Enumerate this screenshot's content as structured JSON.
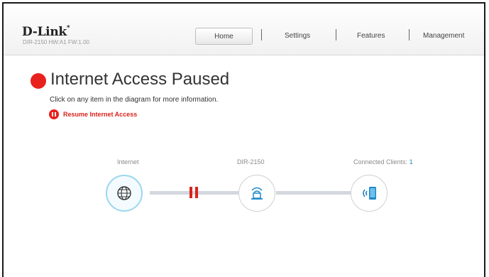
{
  "header": {
    "brand": "D-Link",
    "trademark": "*",
    "hardware_info": "DIR-2150 HW:A1 FW:1.00"
  },
  "nav": {
    "items": [
      "Home",
      "Settings",
      "Features",
      "Management"
    ],
    "active": "Home"
  },
  "status": {
    "title": "Internet Access Paused",
    "subtitle": "Click on any item in the diagram for more information.",
    "resume_label": "Resume Internet Access",
    "color": "#e8201e"
  },
  "diagram": {
    "internet_label": "Internet",
    "router_label": "DIR-2150",
    "clients_label": "Connected Clients:",
    "clients_count": "1",
    "icons": [
      "globe-icon",
      "router-icon",
      "wireless-device-icon"
    ],
    "link_color": "#d3d8de",
    "pause_color": "#d9231d",
    "accent": "#1e88c8"
  }
}
